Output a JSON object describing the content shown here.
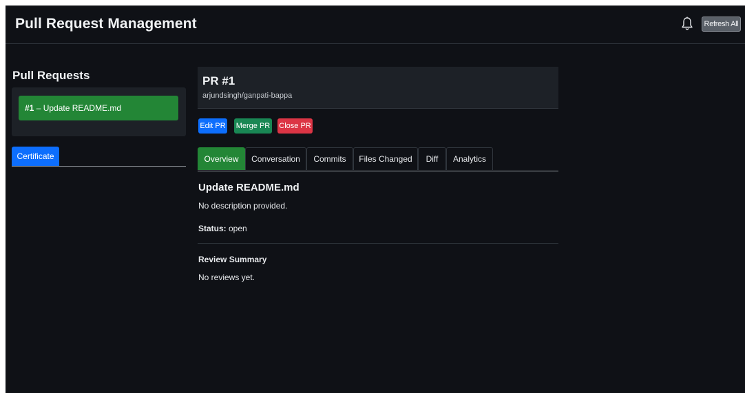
{
  "header": {
    "title": "Pull Request Management",
    "bell_icon": "bell-icon",
    "refresh_label": "Refresh All"
  },
  "sidebar": {
    "title": "Pull Requests",
    "pr_items": [
      {
        "number": "#1",
        "separator": " – ",
        "title": "Update README.md"
      }
    ],
    "tabs": [
      {
        "label": "Certificate"
      }
    ]
  },
  "pr": {
    "title": "PR #1",
    "repo": "arjundsingh/ganpati-bappa",
    "actions": {
      "edit": "Edit PR",
      "merge": "Merge PR",
      "close": "Close PR"
    },
    "tabs": [
      {
        "label": "Overview"
      },
      {
        "label": "Conversation"
      },
      {
        "label": "Commits"
      },
      {
        "label": "Files Changed"
      },
      {
        "label": "Diff"
      },
      {
        "label": "Analytics"
      }
    ],
    "active_tab": "Overview"
  },
  "overview": {
    "title": "Update README.md",
    "description": "No description provided.",
    "status_label": "Status:",
    "status_value": " open",
    "review_title": "Review Summary",
    "review_text": "No reviews yet."
  },
  "colors": {
    "background": "#0f1116",
    "panel": "#1d2127",
    "success": "#238636",
    "primary": "#0d6efd",
    "merge": "#198754",
    "danger": "#dc3545",
    "refresh_button": "#5a6068"
  }
}
